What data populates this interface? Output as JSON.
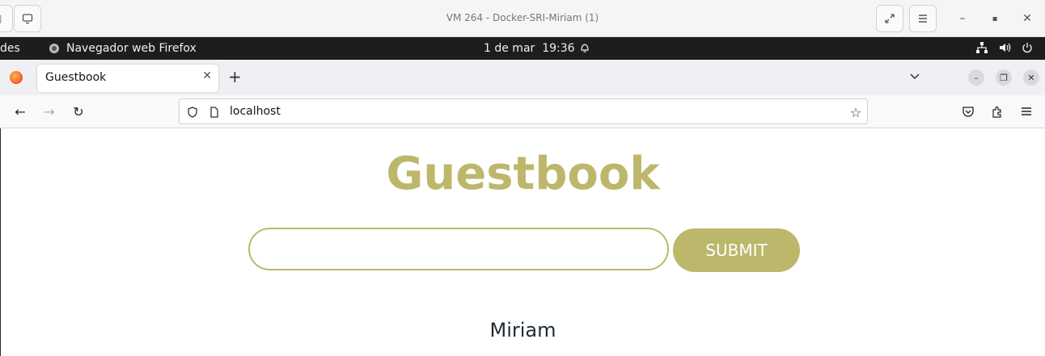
{
  "vm": {
    "title": "VM 264 - Docker-SRI-Miriam (1)",
    "icons": {
      "left_control": "sidebar-icon",
      "display": "display-icon",
      "fullscreen": "expand-icon",
      "menu": "hamburger-icon",
      "minimize": "minimize-icon",
      "maximize": "maximize-icon",
      "close": "close-icon"
    }
  },
  "panel": {
    "activities": "des",
    "app_name": "Navegador web Firefox",
    "date": "1 de mar",
    "time": "19:36"
  },
  "browser": {
    "tab_title": "Guestbook",
    "url": "localhost"
  },
  "page": {
    "heading": "Guestbook",
    "input_value": "",
    "submit_label": "SUBMIT",
    "entries": [
      "Miriam"
    ],
    "accent_color": "#bdb76b"
  }
}
